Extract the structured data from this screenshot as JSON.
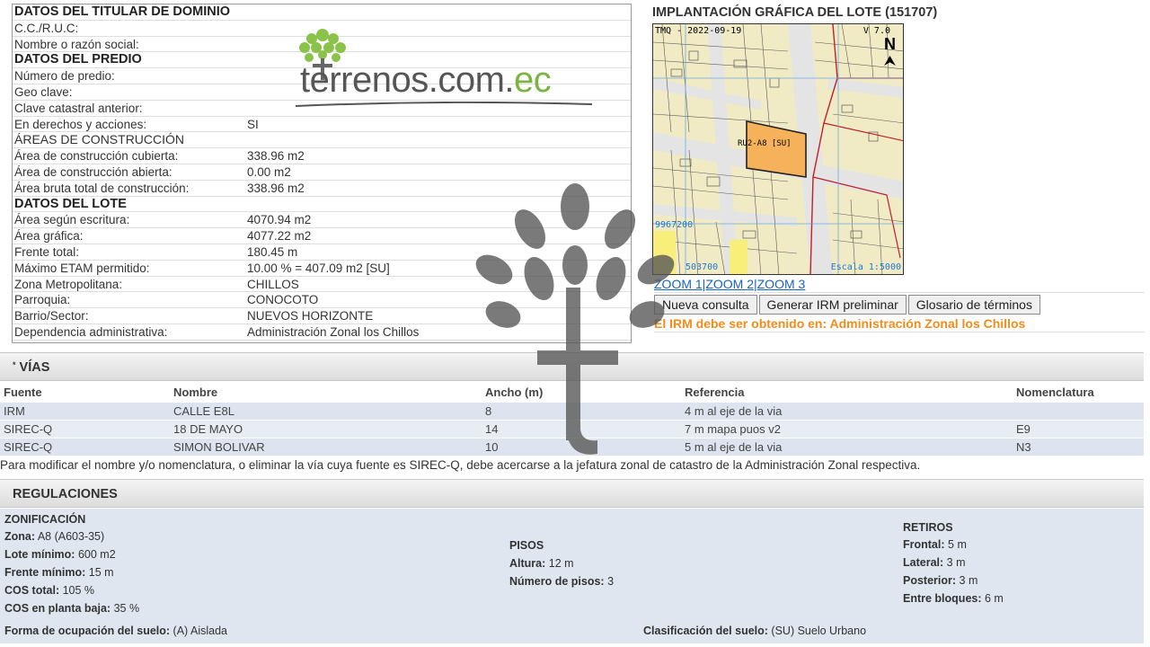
{
  "titular": {
    "heading": "DATOS DEL TITULAR DE DOMINIO",
    "rows": [
      {
        "label": "C.C./R.U.C:",
        "value": ""
      },
      {
        "label": "Nombre o razón social:",
        "value": ""
      }
    ]
  },
  "predio": {
    "heading": "DATOS DEL PREDIO",
    "rows": [
      {
        "label": "Número de predio:",
        "value": ""
      },
      {
        "label": "Geo clave:",
        "value": ""
      },
      {
        "label": "Clave catastral anterior:",
        "value": ""
      },
      {
        "label": "En derechos y acciones:",
        "value": "SI"
      }
    ]
  },
  "construccion": {
    "heading": "ÁREAS DE CONSTRUCCIÓN",
    "rows": [
      {
        "label": "Área de construcción cubierta:",
        "value": "338.96 m2"
      },
      {
        "label": "Área de construcción abierta:",
        "value": "0.00 m2"
      },
      {
        "label": "Área bruta total de construcción:",
        "value": "338.96 m2"
      }
    ]
  },
  "lote": {
    "heading": "DATOS DEL LOTE",
    "rows": [
      {
        "label": "Área según escritura:",
        "value": "4070.94 m2"
      },
      {
        "label": "Área gráfica:",
        "value": "4077.22 m2"
      },
      {
        "label": "Frente total:",
        "value": "180.45 m"
      },
      {
        "label": "Máximo ETAM permitido:",
        "value": "10.00 % = 407.09 m2 [SU]"
      },
      {
        "label": "Zona Metropolitana:",
        "value": "CHILLOS"
      },
      {
        "label": "Parroquia:",
        "value": "CONOCOTO"
      },
      {
        "label": "Barrio/Sector:",
        "value": "NUEVOS HORIZONTE"
      },
      {
        "label": "Dependencia administrativa:",
        "value": "Administración Zonal los Chillos"
      }
    ]
  },
  "logo": {
    "brand_main": "terrenos.com.",
    "brand_accent": "ec"
  },
  "map": {
    "title": "IMPLANTACIÓN GRÁFICA DEL LOTE (151707)",
    "tmq": "TMQ - 2022-09-19",
    "version": "V 7.0",
    "north": "N",
    "coord_y": "9967200",
    "coord_x": "503700",
    "scale": "Escala 1:5000",
    "lot_label": "RU2-A8 [SU]",
    "zoom_links": [
      "ZOOM 1",
      "ZOOM 2",
      "ZOOM 3"
    ],
    "buttons": [
      "Nueva consulta",
      "Generar IRM preliminar",
      "Glosario de términos"
    ],
    "irm_note": "El IRM debe ser obtenido en: Administración Zonal los Chillos"
  },
  "vias": {
    "title": "VÍAS",
    "columns": [
      "Fuente",
      "Nombre",
      "Ancho (m)",
      "Referencia",
      "Nomenclatura"
    ],
    "rows": [
      [
        "IRM",
        "CALLE E8L",
        "8",
        "4 m al eje de la via",
        ""
      ],
      [
        "SIREC-Q",
        "18 DE MAYO",
        "14",
        "7 m mapa puos v2",
        "E9"
      ],
      [
        "SIREC-Q",
        "SIMON BOLIVAR",
        "10",
        "5 m al eje de la via",
        "N3"
      ]
    ],
    "note": "Para modificar el nombre y/o nomenclatura, o eliminar la vía cuya fuente es SIREC-Q, debe acercarse a la jefatura zonal de catastro de la Administración Zonal respectiva."
  },
  "regulaciones": {
    "title": "REGULACIONES",
    "zonificacion": {
      "heading": "ZONIFICACIÓN",
      "items": [
        {
          "k": "Zona:",
          "v": "A8 (A603-35)"
        },
        {
          "k": "Lote mínimo:",
          "v": "600 m2"
        },
        {
          "k": "Frente mínimo:",
          "v": "15 m"
        },
        {
          "k": "COS total:",
          "v": "105 %"
        },
        {
          "k": "COS en planta baja:",
          "v": "35 %"
        }
      ]
    },
    "pisos": {
      "heading": "PISOS",
      "items": [
        {
          "k": "Altura:",
          "v": "12 m"
        },
        {
          "k": "Número de pisos:",
          "v": "3"
        }
      ]
    },
    "retiros": {
      "heading": "RETIROS",
      "items": [
        {
          "k": "Frontal:",
          "v": "5 m"
        },
        {
          "k": "Lateral:",
          "v": "3 m"
        },
        {
          "k": "Posterior:",
          "v": "3 m"
        },
        {
          "k": "Entre bloques:",
          "v": "6 m"
        }
      ]
    },
    "forma": {
      "k": "Forma de ocupación del suelo:",
      "v": "(A) Aislada"
    },
    "clasificacion": {
      "k": "Clasificación del suelo:",
      "v": "(SU) Suelo Urbano"
    }
  },
  "colors": {
    "accent_orange": "#f28c1a",
    "link_blue": "#1565c0",
    "row_blue": "#dde4ef",
    "lot_fill": "#f6b25a",
    "brand_green": "#7cb342"
  }
}
